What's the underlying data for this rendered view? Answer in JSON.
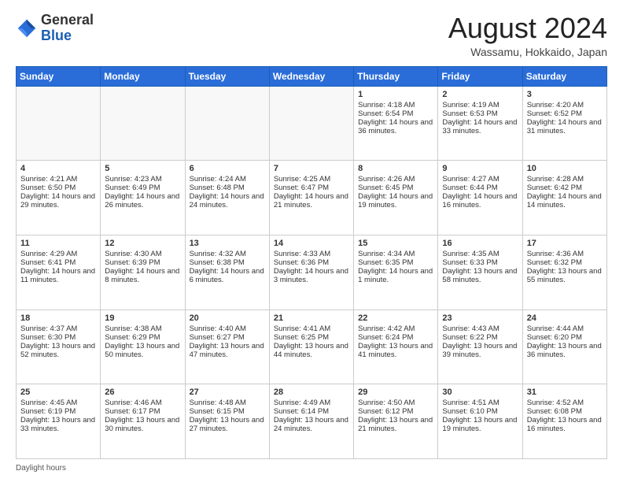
{
  "header": {
    "logo_general": "General",
    "logo_blue": "Blue",
    "title": "August 2024",
    "location": "Wassamu, Hokkaido, Japan"
  },
  "days_of_week": [
    "Sunday",
    "Monday",
    "Tuesday",
    "Wednesday",
    "Thursday",
    "Friday",
    "Saturday"
  ],
  "footer": {
    "daylight_label": "Daylight hours"
  },
  "weeks": [
    [
      {
        "day": "",
        "content": ""
      },
      {
        "day": "",
        "content": ""
      },
      {
        "day": "",
        "content": ""
      },
      {
        "day": "",
        "content": ""
      },
      {
        "day": "1",
        "content": "Sunrise: 4:18 AM\nSunset: 6:54 PM\nDaylight: 14 hours and 36 minutes."
      },
      {
        "day": "2",
        "content": "Sunrise: 4:19 AM\nSunset: 6:53 PM\nDaylight: 14 hours and 33 minutes."
      },
      {
        "day": "3",
        "content": "Sunrise: 4:20 AM\nSunset: 6:52 PM\nDaylight: 14 hours and 31 minutes."
      }
    ],
    [
      {
        "day": "4",
        "content": "Sunrise: 4:21 AM\nSunset: 6:50 PM\nDaylight: 14 hours and 29 minutes."
      },
      {
        "day": "5",
        "content": "Sunrise: 4:23 AM\nSunset: 6:49 PM\nDaylight: 14 hours and 26 minutes."
      },
      {
        "day": "6",
        "content": "Sunrise: 4:24 AM\nSunset: 6:48 PM\nDaylight: 14 hours and 24 minutes."
      },
      {
        "day": "7",
        "content": "Sunrise: 4:25 AM\nSunset: 6:47 PM\nDaylight: 14 hours and 21 minutes."
      },
      {
        "day": "8",
        "content": "Sunrise: 4:26 AM\nSunset: 6:45 PM\nDaylight: 14 hours and 19 minutes."
      },
      {
        "day": "9",
        "content": "Sunrise: 4:27 AM\nSunset: 6:44 PM\nDaylight: 14 hours and 16 minutes."
      },
      {
        "day": "10",
        "content": "Sunrise: 4:28 AM\nSunset: 6:42 PM\nDaylight: 14 hours and 14 minutes."
      }
    ],
    [
      {
        "day": "11",
        "content": "Sunrise: 4:29 AM\nSunset: 6:41 PM\nDaylight: 14 hours and 11 minutes."
      },
      {
        "day": "12",
        "content": "Sunrise: 4:30 AM\nSunset: 6:39 PM\nDaylight: 14 hours and 8 minutes."
      },
      {
        "day": "13",
        "content": "Sunrise: 4:32 AM\nSunset: 6:38 PM\nDaylight: 14 hours and 6 minutes."
      },
      {
        "day": "14",
        "content": "Sunrise: 4:33 AM\nSunset: 6:36 PM\nDaylight: 14 hours and 3 minutes."
      },
      {
        "day": "15",
        "content": "Sunrise: 4:34 AM\nSunset: 6:35 PM\nDaylight: 14 hours and 1 minute."
      },
      {
        "day": "16",
        "content": "Sunrise: 4:35 AM\nSunset: 6:33 PM\nDaylight: 13 hours and 58 minutes."
      },
      {
        "day": "17",
        "content": "Sunrise: 4:36 AM\nSunset: 6:32 PM\nDaylight: 13 hours and 55 minutes."
      }
    ],
    [
      {
        "day": "18",
        "content": "Sunrise: 4:37 AM\nSunset: 6:30 PM\nDaylight: 13 hours and 52 minutes."
      },
      {
        "day": "19",
        "content": "Sunrise: 4:38 AM\nSunset: 6:29 PM\nDaylight: 13 hours and 50 minutes."
      },
      {
        "day": "20",
        "content": "Sunrise: 4:40 AM\nSunset: 6:27 PM\nDaylight: 13 hours and 47 minutes."
      },
      {
        "day": "21",
        "content": "Sunrise: 4:41 AM\nSunset: 6:25 PM\nDaylight: 13 hours and 44 minutes."
      },
      {
        "day": "22",
        "content": "Sunrise: 4:42 AM\nSunset: 6:24 PM\nDaylight: 13 hours and 41 minutes."
      },
      {
        "day": "23",
        "content": "Sunrise: 4:43 AM\nSunset: 6:22 PM\nDaylight: 13 hours and 39 minutes."
      },
      {
        "day": "24",
        "content": "Sunrise: 4:44 AM\nSunset: 6:20 PM\nDaylight: 13 hours and 36 minutes."
      }
    ],
    [
      {
        "day": "25",
        "content": "Sunrise: 4:45 AM\nSunset: 6:19 PM\nDaylight: 13 hours and 33 minutes."
      },
      {
        "day": "26",
        "content": "Sunrise: 4:46 AM\nSunset: 6:17 PM\nDaylight: 13 hours and 30 minutes."
      },
      {
        "day": "27",
        "content": "Sunrise: 4:48 AM\nSunset: 6:15 PM\nDaylight: 13 hours and 27 minutes."
      },
      {
        "day": "28",
        "content": "Sunrise: 4:49 AM\nSunset: 6:14 PM\nDaylight: 13 hours and 24 minutes."
      },
      {
        "day": "29",
        "content": "Sunrise: 4:50 AM\nSunset: 6:12 PM\nDaylight: 13 hours and 21 minutes."
      },
      {
        "day": "30",
        "content": "Sunrise: 4:51 AM\nSunset: 6:10 PM\nDaylight: 13 hours and 19 minutes."
      },
      {
        "day": "31",
        "content": "Sunrise: 4:52 AM\nSunset: 6:08 PM\nDaylight: 13 hours and 16 minutes."
      }
    ]
  ]
}
